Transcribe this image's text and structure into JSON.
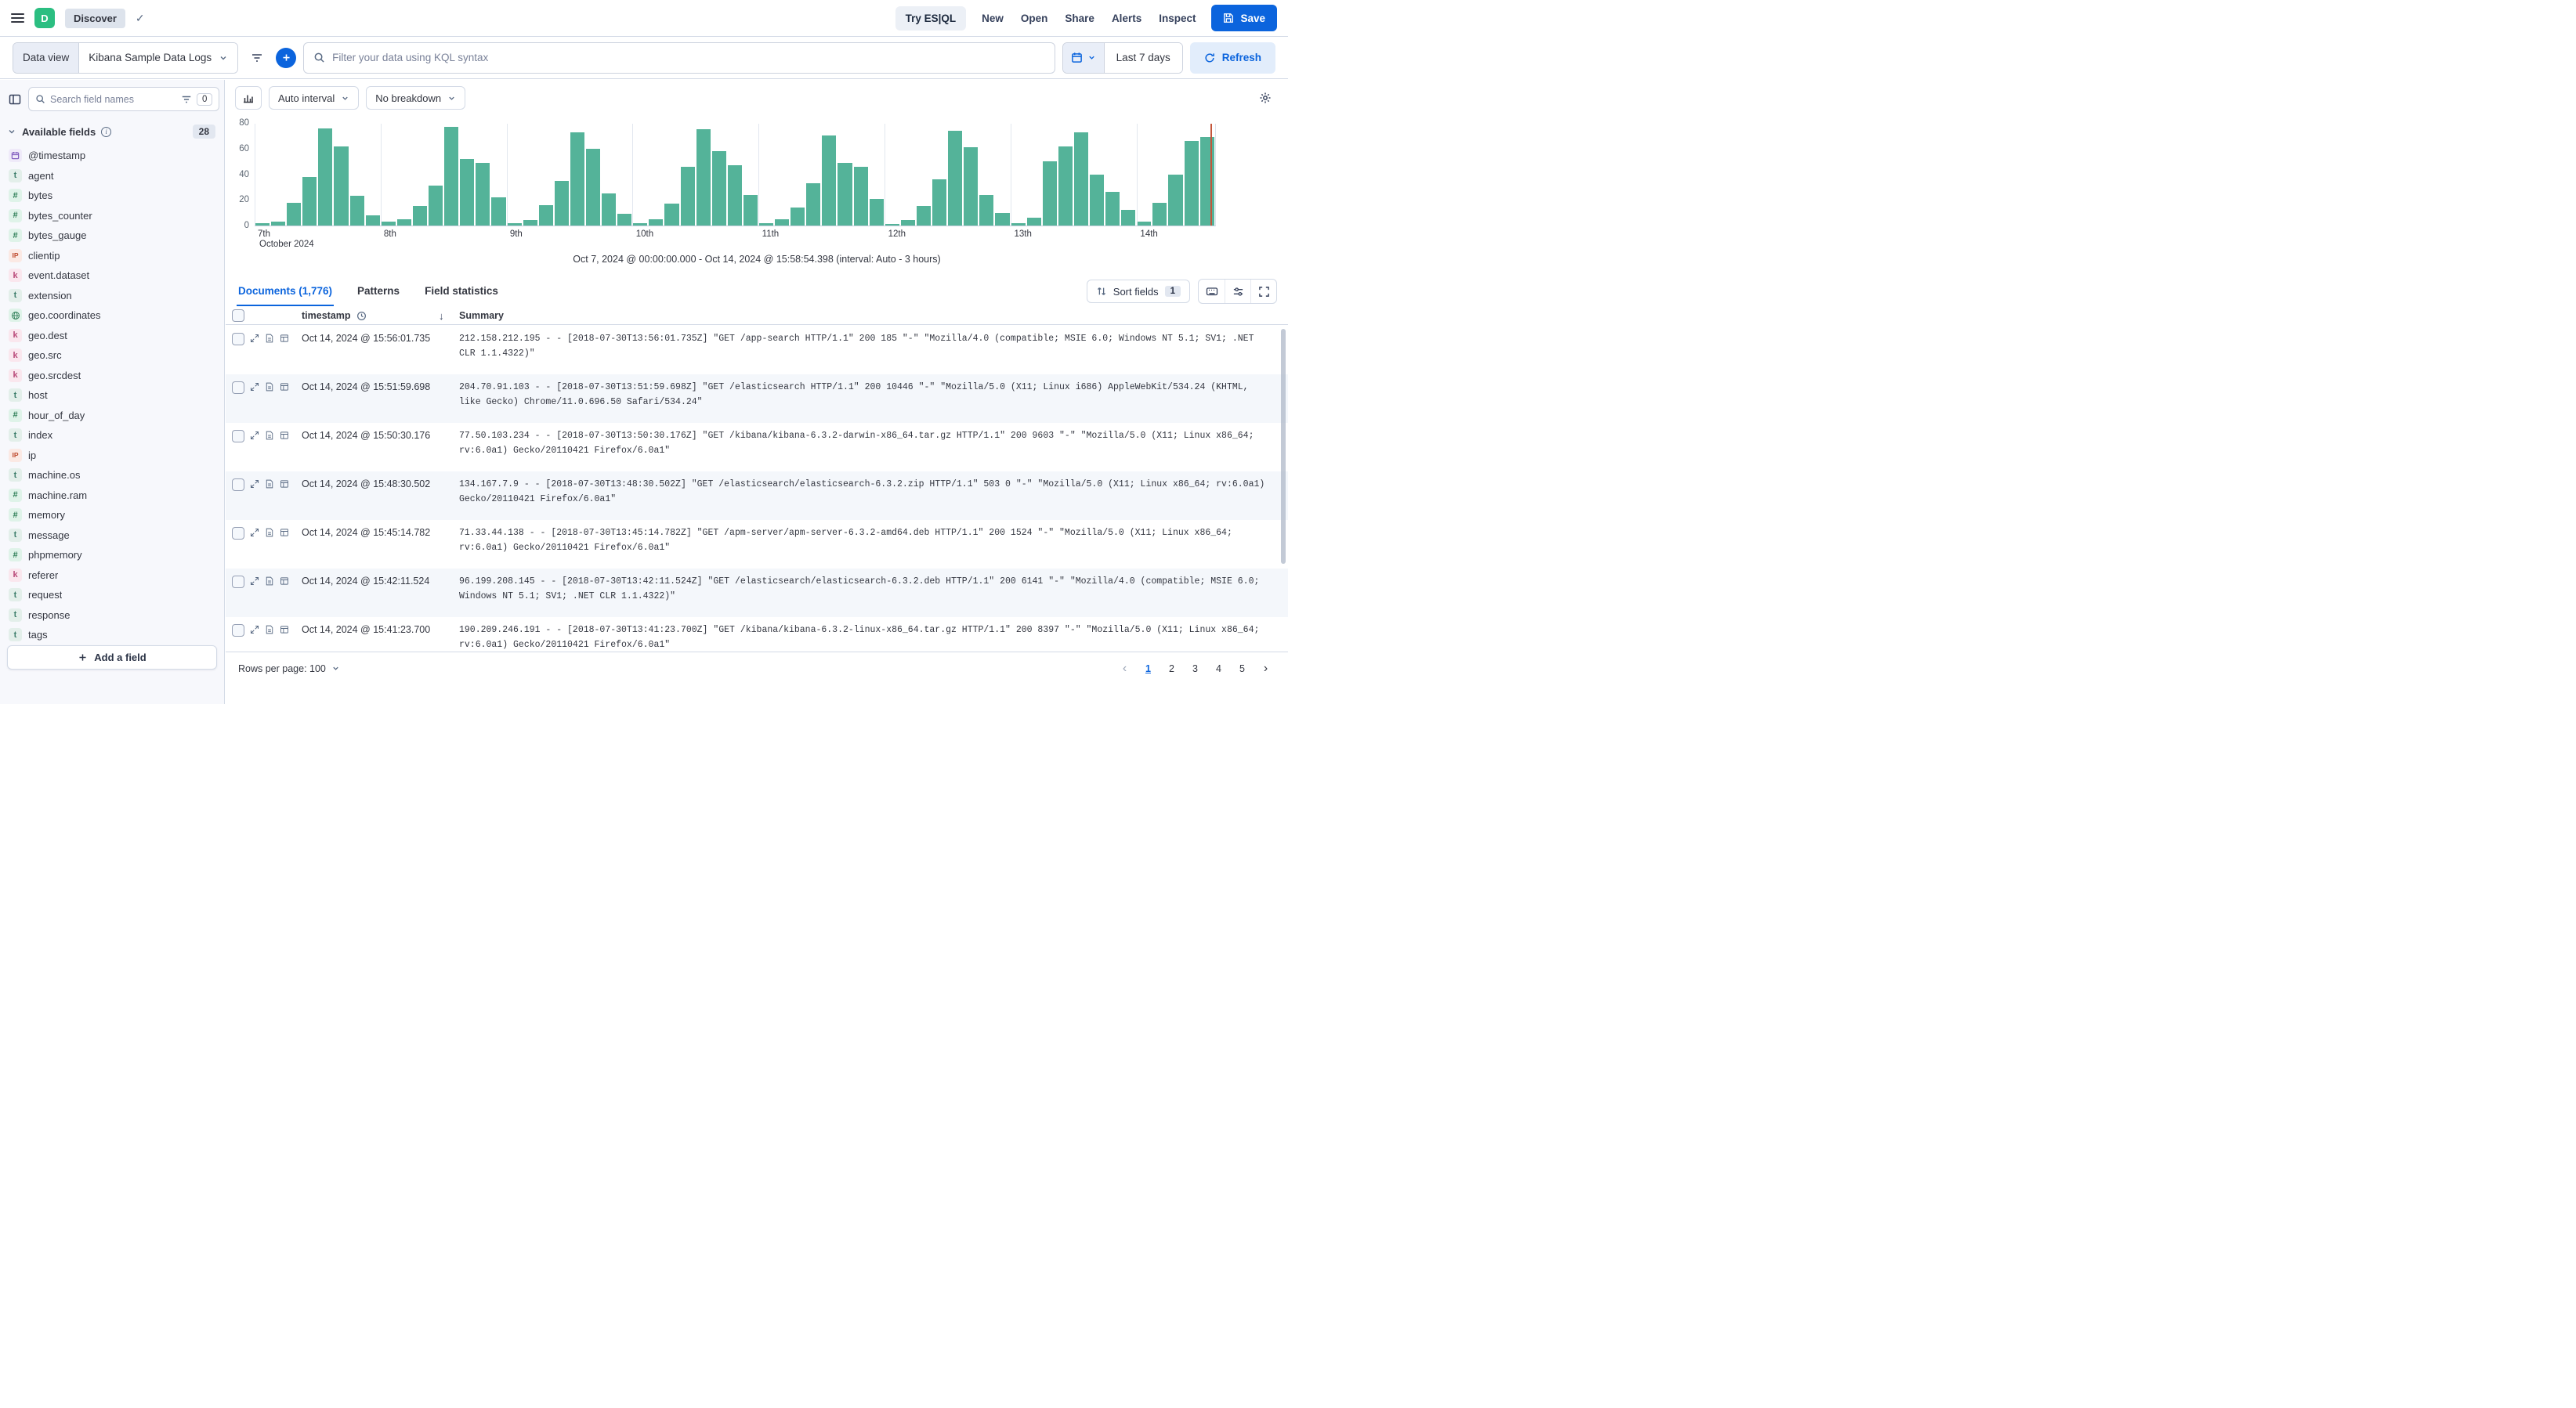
{
  "header": {
    "space_initial": "D",
    "breadcrumb": "Discover",
    "checkmark": "✓",
    "try_esql": "Try ES|QL",
    "nav": [
      "New",
      "Open",
      "Share",
      "Alerts",
      "Inspect"
    ],
    "save": "Save"
  },
  "toolbar": {
    "data_view_label": "Data view",
    "data_view_value": "Kibana Sample Data Logs",
    "kql_placeholder": "Filter your data using KQL syntax",
    "time_range": "Last 7 days",
    "refresh_label": "Refresh"
  },
  "sidebar": {
    "search_placeholder": "Search field names",
    "filter_count": "0",
    "section_title": "Available fields",
    "section_count": "28",
    "add_field_label": "Add a field",
    "fields": [
      {
        "name": "@timestamp",
        "type": "date"
      },
      {
        "name": "agent",
        "type": "text"
      },
      {
        "name": "bytes",
        "type": "number"
      },
      {
        "name": "bytes_counter",
        "type": "number"
      },
      {
        "name": "bytes_gauge",
        "type": "number"
      },
      {
        "name": "clientip",
        "type": "ip"
      },
      {
        "name": "event.dataset",
        "type": "keyword"
      },
      {
        "name": "extension",
        "type": "text"
      },
      {
        "name": "geo.coordinates",
        "type": "geo"
      },
      {
        "name": "geo.dest",
        "type": "keyword"
      },
      {
        "name": "geo.src",
        "type": "keyword"
      },
      {
        "name": "geo.srcdest",
        "type": "keyword"
      },
      {
        "name": "host",
        "type": "text"
      },
      {
        "name": "hour_of_day",
        "type": "number"
      },
      {
        "name": "index",
        "type": "text"
      },
      {
        "name": "ip",
        "type": "ip"
      },
      {
        "name": "machine.os",
        "type": "text"
      },
      {
        "name": "machine.ram",
        "type": "number"
      },
      {
        "name": "memory",
        "type": "number"
      },
      {
        "name": "message",
        "type": "text"
      },
      {
        "name": "phpmemory",
        "type": "number"
      },
      {
        "name": "referer",
        "type": "keyword"
      },
      {
        "name": "request",
        "type": "text"
      },
      {
        "name": "response",
        "type": "text"
      },
      {
        "name": "tags",
        "type": "text"
      }
    ]
  },
  "chart": {
    "interval_label": "Auto interval",
    "breakdown_label": "No breakdown",
    "caption": "Oct 7, 2024 @ 00:00:00.000 - Oct 14, 2024 @ 15:58:54.398 (interval: Auto - 3 hours)"
  },
  "chart_data": {
    "type": "bar",
    "bar_color": "#54B399",
    "current_time_marker_color": "#C4553B",
    "y_axis": {
      "ticks": [
        0,
        20,
        40,
        60,
        80
      ],
      "max": 80
    },
    "x_axis": {
      "day_labels": [
        "7th",
        "8th",
        "9th",
        "10th",
        "11th",
        "12th",
        "13th",
        "14th"
      ],
      "sub_label": "October 2024",
      "bars_per_day": 8,
      "interval": "3 hours"
    },
    "values": [
      2,
      3,
      18,
      38,
      76,
      62,
      23,
      8,
      3,
      5,
      15,
      31,
      77,
      52,
      49,
      22,
      2,
      4,
      16,
      35,
      73,
      60,
      25,
      9,
      2,
      5,
      17,
      46,
      75,
      58,
      47,
      24,
      2,
      5,
      14,
      33,
      70,
      49,
      46,
      21,
      1,
      4,
      15,
      36,
      74,
      61,
      24,
      10,
      2,
      6,
      50,
      62,
      73,
      40,
      26,
      12,
      3,
      18,
      40,
      66,
      69
    ]
  },
  "tabs": {
    "documents": "Documents (1,776)",
    "patterns": "Patterns",
    "field_statistics": "Field statistics",
    "sort_fields": "Sort fields",
    "sort_fields_count": "1"
  },
  "table": {
    "col_timestamp": "timestamp",
    "col_summary": "Summary",
    "sort_arrow": "↓",
    "rows": [
      {
        "timestamp": "Oct 14, 2024 @ 15:56:01.735",
        "summary": "212.158.212.195 - - [2018-07-30T13:56:01.735Z] \"GET /app-search HTTP/1.1\" 200 185 \"-\" \"Mozilla/4.0 (compatible; MSIE 6.0; Windows NT 5.1; SV1; .NET CLR 1.1.4322)\""
      },
      {
        "timestamp": "Oct 14, 2024 @ 15:51:59.698",
        "summary": "204.70.91.103 - - [2018-07-30T13:51:59.698Z] \"GET /elasticsearch HTTP/1.1\" 200 10446 \"-\" \"Mozilla/5.0 (X11; Linux i686) AppleWebKit/534.24 (KHTML, like Gecko) Chrome/11.0.696.50 Safari/534.24\""
      },
      {
        "timestamp": "Oct 14, 2024 @ 15:50:30.176",
        "summary": "77.50.103.234 - - [2018-07-30T13:50:30.176Z] \"GET /kibana/kibana-6.3.2-darwin-x86_64.tar.gz HTTP/1.1\" 200 9603 \"-\" \"Mozilla/5.0 (X11; Linux x86_64; rv:6.0a1) Gecko/20110421 Firefox/6.0a1\""
      },
      {
        "timestamp": "Oct 14, 2024 @ 15:48:30.502",
        "summary": "134.167.7.9 - - [2018-07-30T13:48:30.502Z] \"GET /elasticsearch/elasticsearch-6.3.2.zip HTTP/1.1\" 503 0 \"-\" \"Mozilla/5.0 (X11; Linux x86_64; rv:6.0a1) Gecko/20110421 Firefox/6.0a1\""
      },
      {
        "timestamp": "Oct 14, 2024 @ 15:45:14.782",
        "summary": "71.33.44.138 - - [2018-07-30T13:45:14.782Z] \"GET /apm-server/apm-server-6.3.2-amd64.deb HTTP/1.1\" 200 1524 \"-\" \"Mozilla/5.0 (X11; Linux x86_64; rv:6.0a1) Gecko/20110421 Firefox/6.0a1\""
      },
      {
        "timestamp": "Oct 14, 2024 @ 15:42:11.524",
        "summary": "96.199.208.145 - - [2018-07-30T13:42:11.524Z] \"GET /elasticsearch/elasticsearch-6.3.2.deb HTTP/1.1\" 200 6141 \"-\" \"Mozilla/4.0 (compatible; MSIE 6.0; Windows NT 5.1; SV1; .NET CLR 1.1.4322)\""
      },
      {
        "timestamp": "Oct 14, 2024 @ 15:41:23.700",
        "summary": "190.209.246.191 - - [2018-07-30T13:41:23.700Z] \"GET /kibana/kibana-6.3.2-linux-x86_64.tar.gz HTTP/1.1\" 200 8397 \"-\" \"Mozilla/5.0 (X11; Linux x86_64; rv:6.0a1) Gecko/20110421 Firefox/6.0a1\""
      }
    ]
  },
  "footer": {
    "rows_per_page": "Rows per page: 100",
    "pages": [
      "1",
      "2",
      "3",
      "4",
      "5"
    ],
    "active_page": "1",
    "prev": "‹",
    "next": "›"
  },
  "icons": {
    "menu": "☰",
    "search": "magnifier",
    "add-filter": "plus-in-circle",
    "calendar": "calendar",
    "refresh": "circular-arrow",
    "save": "floppy-disk",
    "clock": "clock",
    "sort-descending": "↓",
    "sort-fields": "up-down-arrows",
    "fullscreen": "corner-brackets",
    "expand-row": "diagonal-arrows",
    "document": "file-with-lines"
  }
}
